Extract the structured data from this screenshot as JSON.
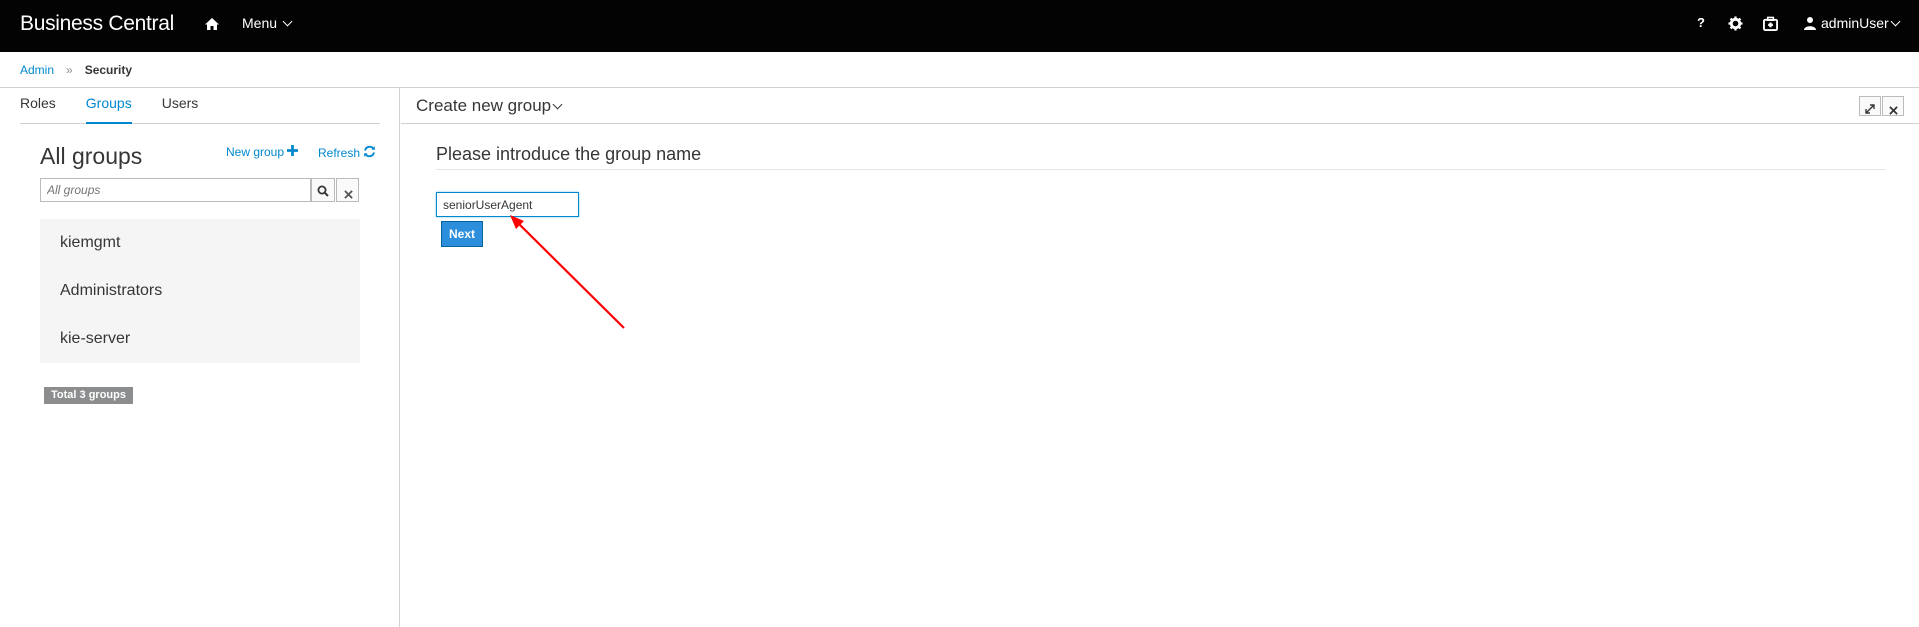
{
  "navbar": {
    "brand": "Business Central",
    "menu_label": "Menu",
    "help_label": "?",
    "user_label": "adminUser"
  },
  "breadcrumb": {
    "root": "Admin",
    "separator": "»",
    "current": "Security"
  },
  "tabs": [
    {
      "label": "Roles",
      "active": false
    },
    {
      "label": "Groups",
      "active": true
    },
    {
      "label": "Users",
      "active": false
    }
  ],
  "groups_panel": {
    "title": "All groups",
    "new_group_label": "New group",
    "refresh_label": "Refresh",
    "search_placeholder": "All groups",
    "items": [
      "kiemgmt",
      "Administrators",
      "kie-server"
    ],
    "total_label": "Total 3 groups"
  },
  "create_panel": {
    "title": "Create new group",
    "form_title": "Please introduce the group name",
    "group_name_value": "seniorUserAgent",
    "next_label": "Next"
  },
  "colors": {
    "navbar_bg": "#030303",
    "accent": "#0088ce",
    "primary_button": "#2d8fdc",
    "annotation_arrow": "#ff0000"
  },
  "icons": [
    "home-icon",
    "settings-icon",
    "briefcase-icon",
    "user-icon",
    "plus-icon",
    "refresh-icon",
    "search-icon",
    "close-icon",
    "expand-icon"
  ]
}
